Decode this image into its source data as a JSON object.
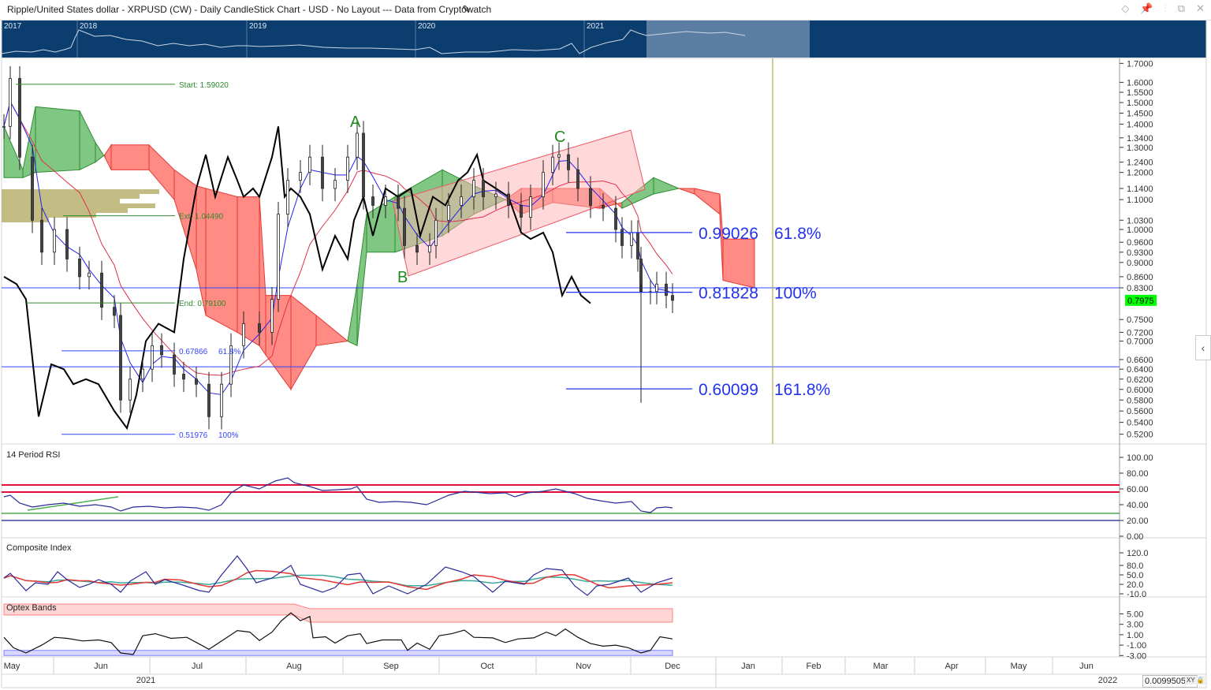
{
  "title": "Ripple/United States dollar - XRPUSD (CW) - Daily CandleStick Chart - USD - No Layout --- Data from Cryptowatch",
  "window_icons": [
    "diamond-icon",
    "pin-icon",
    "thermometer-icon",
    "restore-icon",
    "close-icon"
  ],
  "navigator": {
    "years": [
      "2017",
      "2018",
      "2019",
      "2020",
      "2021"
    ]
  },
  "current_price": "0.7975",
  "readout": "0.0099505",
  "readout_mode": "XY",
  "time_axis": {
    "months": [
      "May",
      "Jun",
      "Jul",
      "Aug",
      "Sep",
      "Oct",
      "Nov",
      "Dec",
      "Jan",
      "Feb",
      "Mar",
      "Apr",
      "May",
      "Jun"
    ],
    "years": [
      "2021",
      "2022"
    ]
  },
  "panels": {
    "rsi": {
      "title": "14 Period RSI"
    },
    "composite": {
      "title": "Composite Index"
    },
    "optex": {
      "title": "Optex Bands"
    }
  },
  "annotations": {
    "fib_left": [
      {
        "label": "Start: 1.59020",
        "price": 1.5902,
        "color": "#2e8b2e"
      },
      {
        "label": "Ext: 1.04490",
        "price": 1.0449,
        "color": "#2e8b2e"
      },
      {
        "label": "End: 0.79100",
        "price": 0.791,
        "color": "#2e8b2e"
      }
    ],
    "fib_left_ext": [
      {
        "value": "0.67866",
        "pct": "61.8%",
        "price": 0.67866
      },
      {
        "value": "0.51976",
        "pct": "100%",
        "price": 0.51976
      }
    ],
    "fib_right": [
      {
        "value": "0.99026",
        "pct": "61.8%",
        "price": 0.99026
      },
      {
        "value": "0.81828",
        "pct": "100%",
        "price": 0.81828
      },
      {
        "value": "0.60099",
        "pct": "161.8%",
        "price": 0.60099
      }
    ],
    "waves": [
      "A",
      "B",
      "C"
    ],
    "hlines": [
      0.83,
      0.645
    ]
  },
  "colors": {
    "navigator": "#0b3d6e",
    "cloud_up": "#2e9a2e",
    "cloud_down": "#ff3b30",
    "tenkan": "#2222ee",
    "kijun": "#e0304a",
    "price_box": "#00ff00"
  },
  "chart_data": {
    "type": "candlestick",
    "symbol": "XRPUSD",
    "x_unit": "days since 2021-05-01",
    "price_axis": {
      "scale": "log",
      "ylim": [
        0.5,
        1.72
      ],
      "ticks": [
        "1.7000",
        "1.6000",
        "1.5500",
        "1.5000",
        "1.4500",
        "1.4000",
        "1.3400",
        "1.3000",
        "1.2400",
        "1.2000",
        "1.1400",
        "1.1000",
        "1.0300",
        "1.0000",
        "0.9600",
        "0.9300",
        "0.9000",
        "0.8600",
        "0.8300",
        "0.7500",
        "0.7200",
        "0.7000",
        "0.6600",
        "0.6400",
        "0.6200",
        "0.6000",
        "0.5800",
        "0.5600",
        "0.5400",
        "0.5200"
      ]
    },
    "closes": [
      [
        0,
        1.39
      ],
      [
        2,
        1.62
      ],
      [
        5,
        1.26
      ],
      [
        9,
        1.03
      ],
      [
        12,
        0.93
      ],
      [
        16,
        1.0
      ],
      [
        20,
        0.91
      ],
      [
        24,
        0.86
      ],
      [
        27,
        0.87
      ],
      [
        31,
        0.78
      ],
      [
        35,
        0.76
      ],
      [
        37,
        0.58
      ],
      [
        40,
        0.62
      ],
      [
        44,
        0.64
      ],
      [
        47,
        0.69
      ],
      [
        50,
        0.67
      ],
      [
        54,
        0.63
      ],
      [
        57,
        0.62
      ],
      [
        61,
        0.61
      ],
      [
        65,
        0.55
      ],
      [
        69,
        0.61
      ],
      [
        72,
        0.69
      ],
      [
        76,
        0.74
      ],
      [
        81,
        0.72
      ],
      [
        85,
        0.8
      ],
      [
        87,
        1.05
      ],
      [
        90,
        1.17
      ],
      [
        94,
        1.2
      ],
      [
        97,
        1.26
      ],
      [
        101,
        1.14
      ],
      [
        105,
        1.17
      ],
      [
        109,
        1.26
      ],
      [
        112,
        1.36
      ],
      [
        114,
        1.11
      ],
      [
        117,
        1.08
      ],
      [
        121,
        1.11
      ],
      [
        125,
        1.07
      ],
      [
        127,
        0.95
      ],
      [
        131,
        0.93
      ],
      [
        135,
        0.95
      ],
      [
        137,
        1.03
      ],
      [
        141,
        1.08
      ],
      [
        145,
        1.11
      ],
      [
        149,
        1.17
      ],
      [
        152,
        1.11
      ],
      [
        156,
        1.12
      ],
      [
        160,
        1.08
      ],
      [
        164,
        1.04
      ],
      [
        167,
        1.11
      ],
      [
        171,
        1.2
      ],
      [
        174,
        1.26
      ],
      [
        176,
        1.27
      ],
      [
        179,
        1.21
      ],
      [
        182,
        1.14
      ],
      [
        186,
        1.08
      ],
      [
        190,
        1.07
      ],
      [
        194,
        1.0
      ],
      [
        196,
        0.95
      ],
      [
        199,
        0.99
      ],
      [
        201,
        0.91
      ],
      [
        202,
        0.82
      ],
      [
        205,
        0.82
      ],
      [
        207,
        0.84
      ],
      [
        210,
        0.81
      ],
      [
        212,
        0.7975
      ]
    ],
    "overlay_line": [
      [
        0,
        0.86
      ],
      [
        4,
        0.84
      ],
      [
        7,
        0.8
      ],
      [
        11,
        0.55
      ],
      [
        15,
        0.65
      ],
      [
        19,
        0.64
      ],
      [
        22,
        0.61
      ],
      [
        26,
        0.62
      ],
      [
        30,
        0.61
      ],
      [
        35,
        0.56
      ],
      [
        39,
        0.53
      ],
      [
        42,
        0.59
      ],
      [
        45,
        0.7
      ],
      [
        49,
        0.74
      ],
      [
        54,
        0.72
      ],
      [
        57,
        0.91
      ],
      [
        61,
        1.14
      ],
      [
        64,
        1.27
      ],
      [
        67,
        1.11
      ],
      [
        71,
        1.26
      ],
      [
        74,
        1.17
      ],
      [
        76,
        1.11
      ],
      [
        79,
        1.14
      ],
      [
        81,
        1.11
      ],
      [
        85,
        1.26
      ],
      [
        87,
        1.39
      ],
      [
        89,
        1.11
      ],
      [
        91,
        1.14
      ],
      [
        94,
        1.11
      ],
      [
        97,
        1.05
      ],
      [
        101,
        0.88
      ],
      [
        105,
        0.98
      ],
      [
        109,
        0.91
      ],
      [
        111,
        1.03
      ],
      [
        114,
        1.11
      ],
      [
        117,
        0.98
      ],
      [
        121,
        1.14
      ],
      [
        125,
        1.11
      ],
      [
        129,
        1.14
      ],
      [
        132,
        0.98
      ],
      [
        136,
        1.11
      ],
      [
        140,
        1.08
      ],
      [
        144,
        1.17
      ],
      [
        147,
        1.2
      ],
      [
        150,
        1.27
      ],
      [
        152,
        1.17
      ],
      [
        156,
        1.14
      ],
      [
        160,
        1.11
      ],
      [
        164,
        0.99
      ],
      [
        167,
        0.97
      ],
      [
        171,
        0.99
      ],
      [
        174,
        0.93
      ],
      [
        177,
        0.81
      ],
      [
        180,
        0.86
      ],
      [
        183,
        0.81
      ],
      [
        186,
        0.79
      ]
    ],
    "ichimoku_cloud": [
      [
        0,
        1.39,
        1.18
      ],
      [
        6,
        1.21,
        1.18
      ],
      [
        10,
        1.48,
        1.2
      ],
      [
        24,
        1.46,
        1.21
      ],
      [
        29,
        1.32,
        1.24
      ],
      [
        32,
        1.26,
        1.27
      ],
      [
        34,
        1.21,
        1.31
      ],
      [
        46,
        1.21,
        1.31
      ],
      [
        54,
        1.1,
        1.21
      ],
      [
        61,
        0.88,
        1.15
      ],
      [
        64,
        0.76,
        1.14
      ],
      [
        74,
        0.72,
        1.11
      ],
      [
        81,
        0.69,
        1.11
      ],
      [
        83,
        0.67,
        0.81
      ],
      [
        91,
        0.6,
        0.81
      ],
      [
        99,
        0.69,
        0.76
      ],
      [
        109,
        0.7,
        0.7
      ],
      [
        112,
        0.84,
        0.69
      ],
      [
        115,
        1.05,
        0.93
      ],
      [
        124,
        1.11,
        0.93
      ],
      [
        139,
        1.21,
        0.98
      ],
      [
        149,
        1.15,
        1.05
      ],
      [
        159,
        1.1,
        1.1
      ],
      [
        164,
        1.05,
        1.14
      ],
      [
        174,
        1.09,
        1.14
      ],
      [
        189,
        1.07,
        1.14
      ],
      [
        196,
        1.09,
        1.07
      ],
      [
        206,
        1.18,
        1.12
      ],
      [
        214,
        1.14,
        1.14
      ],
      [
        219,
        1.12,
        1.14
      ],
      [
        227,
        1.05,
        1.12
      ],
      [
        228,
        0.85,
        0.97
      ],
      [
        238,
        0.83,
        0.97
      ]
    ],
    "rsi": {
      "ticks": [
        "100.00",
        "80.00",
        "60.00",
        "40.00",
        "20.00",
        "0.00"
      ],
      "levels": [
        65,
        56,
        29,
        20
      ],
      "values": [
        [
          0,
          50
        ],
        [
          2,
          52
        ],
        [
          5,
          42
        ],
        [
          9,
          37
        ],
        [
          14,
          40
        ],
        [
          19,
          42
        ],
        [
          24,
          38
        ],
        [
          29,
          40
        ],
        [
          34,
          37
        ],
        [
          37,
          32
        ],
        [
          41,
          37
        ],
        [
          46,
          38
        ],
        [
          51,
          36
        ],
        [
          56,
          37
        ],
        [
          61,
          36
        ],
        [
          65,
          33
        ],
        [
          69,
          40
        ],
        [
          72,
          55
        ],
        [
          76,
          65
        ],
        [
          81,
          60
        ],
        [
          86,
          70
        ],
        [
          90,
          74
        ],
        [
          92,
          68
        ],
        [
          97,
          63
        ],
        [
          101,
          58
        ],
        [
          106,
          59
        ],
        [
          110,
          60
        ],
        [
          112,
          63
        ],
        [
          115,
          47
        ],
        [
          119,
          43
        ],
        [
          124,
          44
        ],
        [
          129,
          43
        ],
        [
          134,
          40
        ],
        [
          137,
          45
        ],
        [
          141,
          52
        ],
        [
          146,
          57
        ],
        [
          149,
          56
        ],
        [
          154,
          54
        ],
        [
          159,
          55
        ],
        [
          162,
          50
        ],
        [
          166,
          55
        ],
        [
          171,
          57
        ],
        [
          175,
          60
        ],
        [
          177,
          58
        ],
        [
          181,
          54
        ],
        [
          185,
          48
        ],
        [
          189,
          45
        ],
        [
          194,
          42
        ],
        [
          199,
          44
        ],
        [
          202,
          32
        ],
        [
          205,
          30
        ],
        [
          207,
          36
        ],
        [
          210,
          37
        ],
        [
          212,
          36
        ]
      ]
    },
    "composite": {
      "ticks": [
        "120.0",
        "80.0",
        "50.0",
        "20.0",
        "-10.0"
      ],
      "values": [
        [
          0,
          40
        ],
        [
          2,
          55
        ],
        [
          7,
          0
        ],
        [
          10,
          25
        ],
        [
          14,
          20
        ],
        [
          17,
          60
        ],
        [
          20,
          35
        ],
        [
          24,
          10
        ],
        [
          27,
          20
        ],
        [
          30,
          35
        ],
        [
          34,
          20
        ],
        [
          37,
          -5
        ],
        [
          40,
          30
        ],
        [
          45,
          60
        ],
        [
          48,
          20
        ],
        [
          51,
          35
        ],
        [
          56,
          20
        ],
        [
          62,
          0
        ],
        [
          65,
          -5
        ],
        [
          69,
          50
        ],
        [
          74,
          110
        ],
        [
          77,
          70
        ],
        [
          80,
          25
        ],
        [
          85,
          40
        ],
        [
          91,
          80
        ],
        [
          94,
          20
        ],
        [
          101,
          -5
        ],
        [
          105,
          10
        ],
        [
          109,
          50
        ],
        [
          113,
          55
        ],
        [
          117,
          -10
        ],
        [
          122,
          15
        ],
        [
          128,
          -10
        ],
        [
          134,
          20
        ],
        [
          140,
          75
        ],
        [
          145,
          60
        ],
        [
          149,
          45
        ],
        [
          155,
          -5
        ],
        [
          159,
          30
        ],
        [
          165,
          20
        ],
        [
          168,
          50
        ],
        [
          172,
          70
        ],
        [
          177,
          65
        ],
        [
          181,
          15
        ],
        [
          185,
          -15
        ],
        [
          188,
          15
        ],
        [
          192,
          20
        ],
        [
          198,
          40
        ],
        [
          202,
          -5
        ],
        [
          207,
          25
        ],
        [
          212,
          40
        ]
      ]
    },
    "optex": {
      "ticks": [
        "5.00",
        "3.00",
        "1.00",
        "-1.00",
        "-3.00"
      ],
      "upper_band": [
        [
          0,
          6.9,
          4.8
        ],
        [
          92,
          6.9,
          4.8
        ],
        [
          97,
          6.0,
          3.4
        ],
        [
          212,
          6.0,
          3.4
        ]
      ],
      "lower_band": [
        [
          0,
          -2.0,
          -3.0
        ],
        [
          212,
          -2.0,
          -3.0
        ]
      ],
      "values": [
        [
          0,
          0.5
        ],
        [
          3,
          -1.5
        ],
        [
          7,
          -2.5
        ],
        [
          12,
          -1
        ],
        [
          16,
          0.5
        ],
        [
          20,
          0.3
        ],
        [
          25,
          -0.2
        ],
        [
          30,
          0
        ],
        [
          34,
          -0.5
        ],
        [
          37,
          -2.5
        ],
        [
          41,
          -2.8
        ],
        [
          44,
          0.8
        ],
        [
          48,
          1.2
        ],
        [
          53,
          0.3
        ],
        [
          58,
          0.5
        ],
        [
          62,
          -0.8
        ],
        [
          65,
          -1.8
        ],
        [
          70,
          0.2
        ],
        [
          74,
          1.8
        ],
        [
          78,
          1.5
        ],
        [
          81,
          -0.1
        ],
        [
          85,
          1.5
        ],
        [
          88,
          3.7
        ],
        [
          91,
          5.2
        ],
        [
          94,
          3.7
        ],
        [
          97,
          4.5
        ],
        [
          98,
          0.4
        ],
        [
          102,
          0.6
        ],
        [
          105,
          -0.6
        ],
        [
          109,
          0.8
        ],
        [
          113,
          1.2
        ],
        [
          115,
          -0.7
        ],
        [
          120,
          0
        ],
        [
          126,
          0
        ],
        [
          128,
          -2.0
        ],
        [
          131,
          -0.6
        ],
        [
          135,
          -1.8
        ],
        [
          138,
          0.8
        ],
        [
          142,
          1.2
        ],
        [
          146,
          1.9
        ],
        [
          149,
          0.5
        ],
        [
          155,
          0.4
        ],
        [
          159,
          -0.5
        ],
        [
          163,
          0.2
        ],
        [
          168,
          0.4
        ],
        [
          172,
          1.5
        ],
        [
          175,
          0.8
        ],
        [
          178,
          2.1
        ],
        [
          182,
          0.5
        ],
        [
          186,
          -0.7
        ],
        [
          190,
          -1.2
        ],
        [
          194,
          -1.0
        ],
        [
          198,
          -1.5
        ],
        [
          202,
          -2.5
        ],
        [
          205,
          -2.0
        ],
        [
          208,
          0.6
        ],
        [
          212,
          0.2
        ]
      ]
    }
  }
}
